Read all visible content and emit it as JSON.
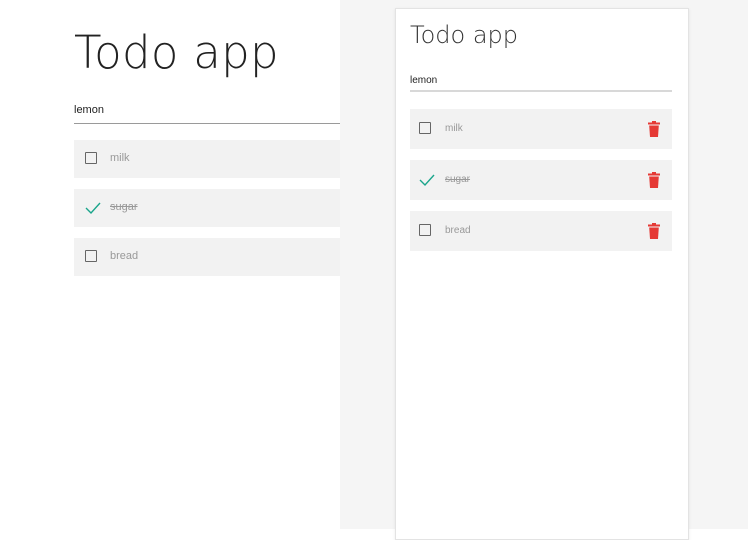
{
  "colors": {
    "check": "#1aa58b",
    "trash": "#e53935",
    "item_bg": "#f2f2f2"
  },
  "left": {
    "title": "Todo app",
    "input_value": "lemon",
    "items": [
      {
        "label": "milk",
        "done": false,
        "icon": "checkbox-empty-icon"
      },
      {
        "label": "sugar",
        "done": true,
        "icon": "checkmark-icon"
      },
      {
        "label": "bread",
        "done": false,
        "icon": "checkbox-empty-icon"
      }
    ]
  },
  "right": {
    "title": "Todo app",
    "input_value": "lemon",
    "items": [
      {
        "label": "milk",
        "done": false,
        "icon": "checkbox-empty-icon",
        "delete_icon": "trash-icon"
      },
      {
        "label": "sugar",
        "done": true,
        "icon": "checkmark-icon",
        "delete_icon": "trash-icon"
      },
      {
        "label": "bread",
        "done": false,
        "icon": "checkbox-empty-icon",
        "delete_icon": "trash-icon"
      }
    ]
  }
}
